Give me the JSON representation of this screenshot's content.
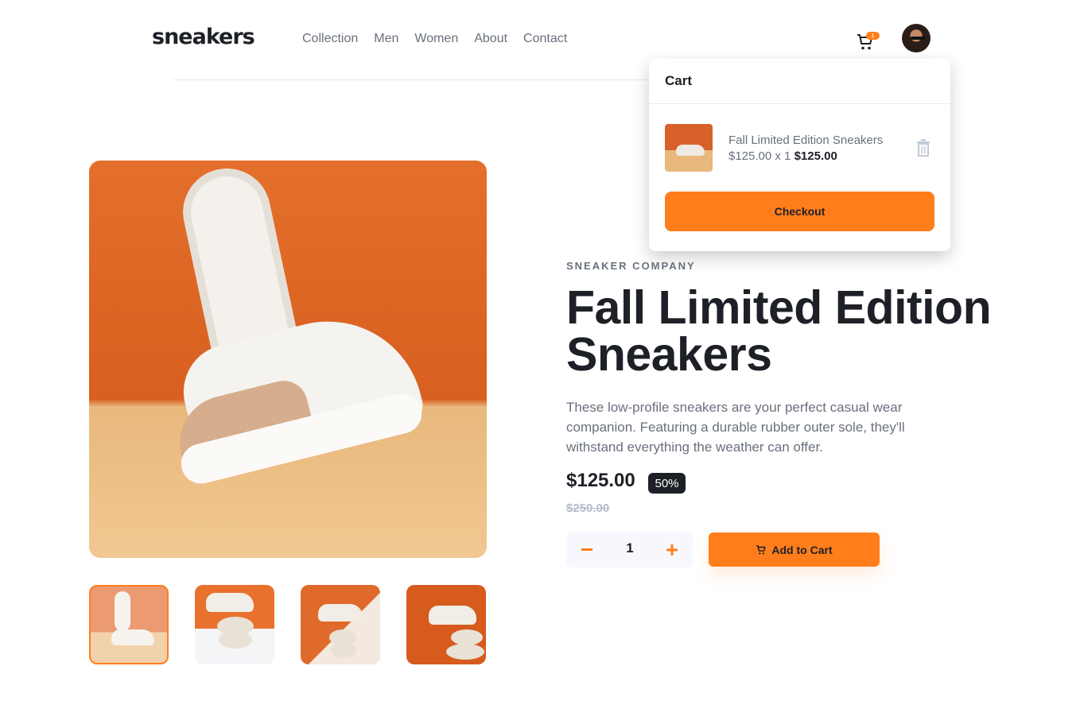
{
  "header": {
    "logo": "sneakers",
    "nav": [
      "Collection",
      "Men",
      "Women",
      "About",
      "Contact"
    ],
    "cart_count": "1",
    "icons": {
      "cart": "cart-icon",
      "avatar": "avatar"
    }
  },
  "cart": {
    "title": "Cart",
    "item": {
      "name": "Fall Limited Edition Sneakers",
      "calc": "$125.00 x 1",
      "total": "$125.00"
    },
    "checkout_label": "Checkout"
  },
  "product": {
    "company": "SNEAKER COMPANY",
    "name": "Fall Limited Edition Sneakers",
    "description": "These low-profile sneakers are your perfect casual wear companion. Featuring a durable rubber outer sole, they'll withstand everything the weather can offer.",
    "price": "$125.00",
    "discount": "50%",
    "old_price": "$250.00",
    "quantity": "1",
    "add_to_cart_label": "Add to Cart"
  },
  "colors": {
    "accent": "#ff7e1b",
    "dark": "#1d2026",
    "muted": "#69707d"
  }
}
